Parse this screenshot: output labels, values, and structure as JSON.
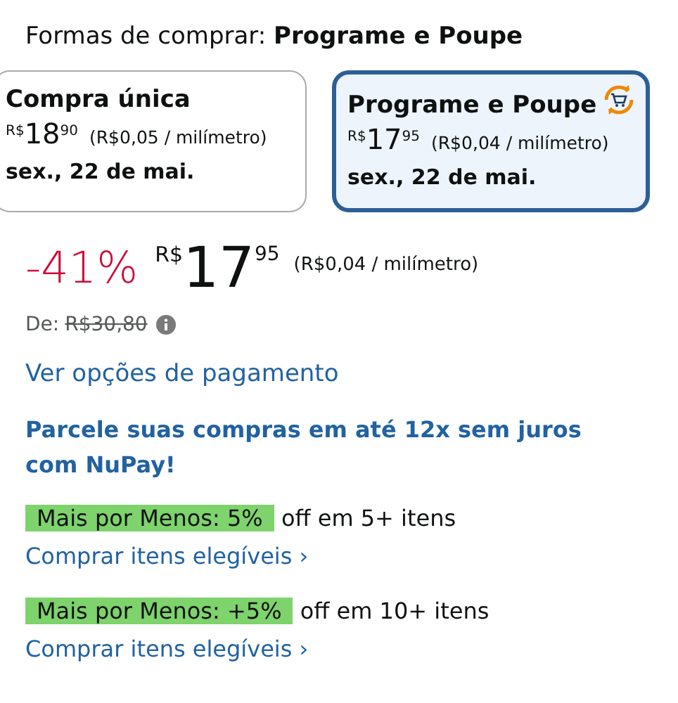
{
  "purchase_options": {
    "label": "Formas de comprar:",
    "value": "Programe e Poupe"
  },
  "options": [
    {
      "title": "Compra única",
      "currency": "R$",
      "whole": "18",
      "fraction": "90",
      "unit_price": "(R$0,05 / milímetro)",
      "delivery": "sex., 22 de mai.",
      "selected": false,
      "subscribe_icon": false
    },
    {
      "title": "Programe e Poupe",
      "currency": "R$",
      "whole": "17",
      "fraction": "95",
      "unit_price": "(R$0,04 / milímetro)",
      "delivery": "sex., 22 de mai.",
      "selected": true,
      "subscribe_icon": true
    }
  ],
  "price": {
    "discount": "-41%",
    "currency": "R$",
    "whole": "17",
    "fraction": "95",
    "unit_price": "(R$0,04 / milímetro)"
  },
  "list_price": {
    "label": "De:",
    "value": "R$30,80"
  },
  "payment_link": "Ver opções de pagamento",
  "installment_text": "Parcele suas compras em até 12x sem juros com NuPay!",
  "promotions": [
    {
      "badge": "Mais por Menos: 5%",
      "text": "off em 5+ itens",
      "link": "Comprar itens elegíveis",
      "chevron": "›"
    },
    {
      "badge": "Mais por Menos: +5%",
      "text": "off em 10+ itens",
      "link": "Comprar itens elegíveis",
      "chevron": "›"
    }
  ]
}
